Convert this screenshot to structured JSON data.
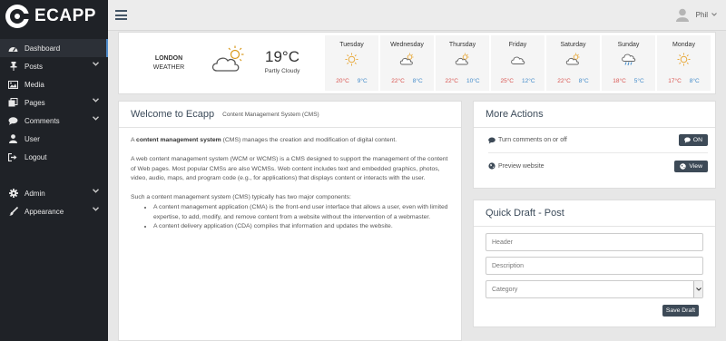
{
  "app": {
    "name": "ECAPP"
  },
  "sidebar": {
    "items": [
      {
        "label": "Dashboard",
        "icon": "dashboard-icon"
      },
      {
        "label": "Posts",
        "icon": "pin-icon"
      },
      {
        "label": "Media",
        "icon": "image-icon"
      },
      {
        "label": "Pages",
        "icon": "pages-icon"
      },
      {
        "label": "Comments",
        "icon": "comment-icon"
      },
      {
        "label": "User",
        "icon": "user-icon"
      },
      {
        "label": "Logout",
        "icon": "logout-icon"
      },
      {
        "label": "Admin",
        "icon": "gear-icon"
      },
      {
        "label": "Appearance",
        "icon": "brush-icon"
      }
    ]
  },
  "topbar": {
    "user_name": "Phil"
  },
  "weather": {
    "city": "LONDON",
    "label": "WEATHER",
    "current_temp": "19°C",
    "current_desc": "Partly Cloudy",
    "days": [
      {
        "name": "Tuesday",
        "icon": "sun-icon",
        "hi": "20°C",
        "lo": "9°C"
      },
      {
        "name": "Wednesday",
        "icon": "partly-cloudy-icon",
        "hi": "22°C",
        "lo": "8°C"
      },
      {
        "name": "Thursday",
        "icon": "partly-cloudy-icon",
        "hi": "22°C",
        "lo": "10°C"
      },
      {
        "name": "Friday",
        "icon": "cloud-icon",
        "hi": "25°C",
        "lo": "12°C"
      },
      {
        "name": "Saturday",
        "icon": "partly-cloudy-icon",
        "hi": "22°C",
        "lo": "8°C"
      },
      {
        "name": "Sunday",
        "icon": "rain-icon",
        "hi": "18°C",
        "lo": "5°C"
      },
      {
        "name": "Monday",
        "icon": "sun-icon",
        "hi": "17°C",
        "lo": "8°C"
      }
    ]
  },
  "welcome": {
    "title": "Welcome to Ecapp",
    "subtitle": "Content Management System (CMS)",
    "p1_pre": "A ",
    "p1_bold": "content management system",
    "p1_post": " (CMS) manages the creation and modification of digital content.",
    "p2": "A web content management system (WCM or WCMS) is a CMS designed to support the management of the content of Web pages. Most popular CMSs are also WCMSs. Web content includes text and embedded graphics, photos, video, audio, maps, and program code (e.g., for applications) that displays content or interacts with the user.",
    "p3": "Such a content management system (CMS) typically has two major components:",
    "bullets": [
      "A content management application (CMA) is the front-end user interface that allows a user, even with limited expertise, to add, modify, and remove content from a website without the intervention of a webmaster.",
      "A content delivery application (CDA) compiles that information and updates the website."
    ]
  },
  "actions": {
    "title": "More Actions",
    "rows": [
      {
        "label": "Turn comments on or off",
        "button": "ON"
      },
      {
        "label": "Preview website",
        "button": "View"
      }
    ]
  },
  "draft": {
    "title": "Quick Draft - Post",
    "header_placeholder": "Header",
    "description_placeholder": "Description",
    "category_value": "Category",
    "save_label": "Save Draft"
  }
}
